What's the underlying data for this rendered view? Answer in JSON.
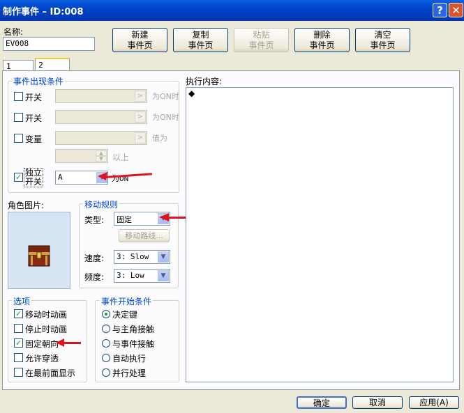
{
  "window": {
    "title": "制作事件 – ID:008",
    "help_label": "?",
    "close_label": "✕"
  },
  "name": {
    "label": "名称:",
    "value": "EV008"
  },
  "toolbar": {
    "new": "新建\n事件页",
    "copy": "复制\n事件页",
    "paste": "粘贴\n事件页",
    "delete": "删除\n事件页",
    "clear": "清空\n事件页"
  },
  "tabs": [
    "1",
    "2"
  ],
  "conditions": {
    "title": "事件出现条件",
    "switch1": {
      "label": "开关",
      "suffix": "为ON时",
      "checked": false
    },
    "switch2": {
      "label": "开关",
      "suffix": "为ON时",
      "checked": false
    },
    "variable": {
      "label": "变量",
      "suffix": "值为",
      "checked": false
    },
    "variable_above": "以上",
    "self_switch": {
      "label_line1": "独立",
      "label_line2": "开关",
      "value": "A",
      "suffix": "为ON",
      "checked": true
    }
  },
  "graphic": {
    "label": "角色图片:"
  },
  "movement": {
    "title": "移动规则",
    "type_label": "类型:",
    "type_value": "固定",
    "route_button": "移动路线...",
    "speed_label": "速度:",
    "speed_value": "3: Slow",
    "freq_label": "频度:",
    "freq_value": "3: Low"
  },
  "options": {
    "title": "选项",
    "items": [
      {
        "label": "移动时动画",
        "checked": true
      },
      {
        "label": "停止时动画",
        "checked": false
      },
      {
        "label": "固定朝向",
        "checked": true
      },
      {
        "label": "允许穿透",
        "checked": false
      },
      {
        "label": "在最前面显示",
        "checked": false
      }
    ]
  },
  "trigger": {
    "title": "事件开始条件",
    "items": [
      {
        "label": "决定键",
        "selected": true
      },
      {
        "label": "与主角接触",
        "selected": false
      },
      {
        "label": "与事件接触",
        "selected": false
      },
      {
        "label": "自动执行",
        "selected": false
      },
      {
        "label": "并行处理",
        "selected": false
      }
    ]
  },
  "commands": {
    "label": "执行内容:",
    "first_line": "◆"
  },
  "footer": {
    "ok": "确定",
    "cancel": "取消",
    "apply": "应用(A)"
  },
  "colors": {
    "accent": "#0046d5",
    "annotation_arrow": "#e0141e",
    "check": "#21a121"
  }
}
